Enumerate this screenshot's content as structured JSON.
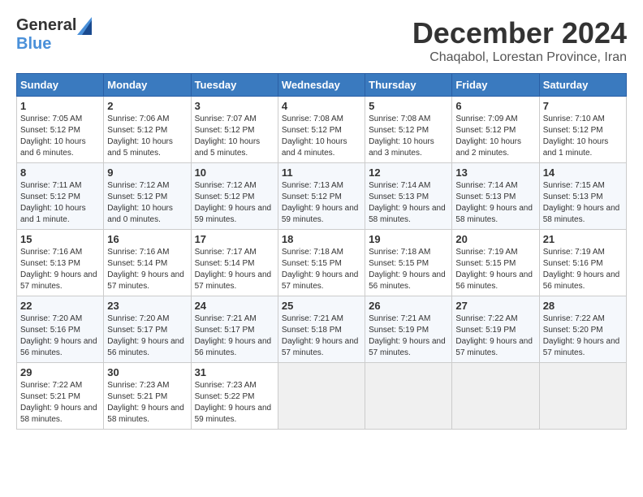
{
  "logo": {
    "general": "General",
    "blue": "Blue"
  },
  "header": {
    "month": "December 2024",
    "location": "Chaqabol, Lorestan Province, Iran"
  },
  "weekdays": [
    "Sunday",
    "Monday",
    "Tuesday",
    "Wednesday",
    "Thursday",
    "Friday",
    "Saturday"
  ],
  "weeks": [
    [
      {
        "day": "1",
        "sunrise": "7:05 AM",
        "sunset": "5:12 PM",
        "daylight": "10 hours and 6 minutes."
      },
      {
        "day": "2",
        "sunrise": "7:06 AM",
        "sunset": "5:12 PM",
        "daylight": "10 hours and 5 minutes."
      },
      {
        "day": "3",
        "sunrise": "7:07 AM",
        "sunset": "5:12 PM",
        "daylight": "10 hours and 5 minutes."
      },
      {
        "day": "4",
        "sunrise": "7:08 AM",
        "sunset": "5:12 PM",
        "daylight": "10 hours and 4 minutes."
      },
      {
        "day": "5",
        "sunrise": "7:08 AM",
        "sunset": "5:12 PM",
        "daylight": "10 hours and 3 minutes."
      },
      {
        "day": "6",
        "sunrise": "7:09 AM",
        "sunset": "5:12 PM",
        "daylight": "10 hours and 2 minutes."
      },
      {
        "day": "7",
        "sunrise": "7:10 AM",
        "sunset": "5:12 PM",
        "daylight": "10 hours and 1 minute."
      }
    ],
    [
      {
        "day": "8",
        "sunrise": "7:11 AM",
        "sunset": "5:12 PM",
        "daylight": "10 hours and 1 minute."
      },
      {
        "day": "9",
        "sunrise": "7:12 AM",
        "sunset": "5:12 PM",
        "daylight": "10 hours and 0 minutes."
      },
      {
        "day": "10",
        "sunrise": "7:12 AM",
        "sunset": "5:12 PM",
        "daylight": "9 hours and 59 minutes."
      },
      {
        "day": "11",
        "sunrise": "7:13 AM",
        "sunset": "5:12 PM",
        "daylight": "9 hours and 59 minutes."
      },
      {
        "day": "12",
        "sunrise": "7:14 AM",
        "sunset": "5:13 PM",
        "daylight": "9 hours and 58 minutes."
      },
      {
        "day": "13",
        "sunrise": "7:14 AM",
        "sunset": "5:13 PM",
        "daylight": "9 hours and 58 minutes."
      },
      {
        "day": "14",
        "sunrise": "7:15 AM",
        "sunset": "5:13 PM",
        "daylight": "9 hours and 58 minutes."
      }
    ],
    [
      {
        "day": "15",
        "sunrise": "7:16 AM",
        "sunset": "5:13 PM",
        "daylight": "9 hours and 57 minutes."
      },
      {
        "day": "16",
        "sunrise": "7:16 AM",
        "sunset": "5:14 PM",
        "daylight": "9 hours and 57 minutes."
      },
      {
        "day": "17",
        "sunrise": "7:17 AM",
        "sunset": "5:14 PM",
        "daylight": "9 hours and 57 minutes."
      },
      {
        "day": "18",
        "sunrise": "7:18 AM",
        "sunset": "5:15 PM",
        "daylight": "9 hours and 57 minutes."
      },
      {
        "day": "19",
        "sunrise": "7:18 AM",
        "sunset": "5:15 PM",
        "daylight": "9 hours and 56 minutes."
      },
      {
        "day": "20",
        "sunrise": "7:19 AM",
        "sunset": "5:15 PM",
        "daylight": "9 hours and 56 minutes."
      },
      {
        "day": "21",
        "sunrise": "7:19 AM",
        "sunset": "5:16 PM",
        "daylight": "9 hours and 56 minutes."
      }
    ],
    [
      {
        "day": "22",
        "sunrise": "7:20 AM",
        "sunset": "5:16 PM",
        "daylight": "9 hours and 56 minutes."
      },
      {
        "day": "23",
        "sunrise": "7:20 AM",
        "sunset": "5:17 PM",
        "daylight": "9 hours and 56 minutes."
      },
      {
        "day": "24",
        "sunrise": "7:21 AM",
        "sunset": "5:17 PM",
        "daylight": "9 hours and 56 minutes."
      },
      {
        "day": "25",
        "sunrise": "7:21 AM",
        "sunset": "5:18 PM",
        "daylight": "9 hours and 57 minutes."
      },
      {
        "day": "26",
        "sunrise": "7:21 AM",
        "sunset": "5:19 PM",
        "daylight": "9 hours and 57 minutes."
      },
      {
        "day": "27",
        "sunrise": "7:22 AM",
        "sunset": "5:19 PM",
        "daylight": "9 hours and 57 minutes."
      },
      {
        "day": "28",
        "sunrise": "7:22 AM",
        "sunset": "5:20 PM",
        "daylight": "9 hours and 57 minutes."
      }
    ],
    [
      {
        "day": "29",
        "sunrise": "7:22 AM",
        "sunset": "5:21 PM",
        "daylight": "9 hours and 58 minutes."
      },
      {
        "day": "30",
        "sunrise": "7:23 AM",
        "sunset": "5:21 PM",
        "daylight": "9 hours and 58 minutes."
      },
      {
        "day": "31",
        "sunrise": "7:23 AM",
        "sunset": "5:22 PM",
        "daylight": "9 hours and 59 minutes."
      },
      null,
      null,
      null,
      null
    ]
  ]
}
